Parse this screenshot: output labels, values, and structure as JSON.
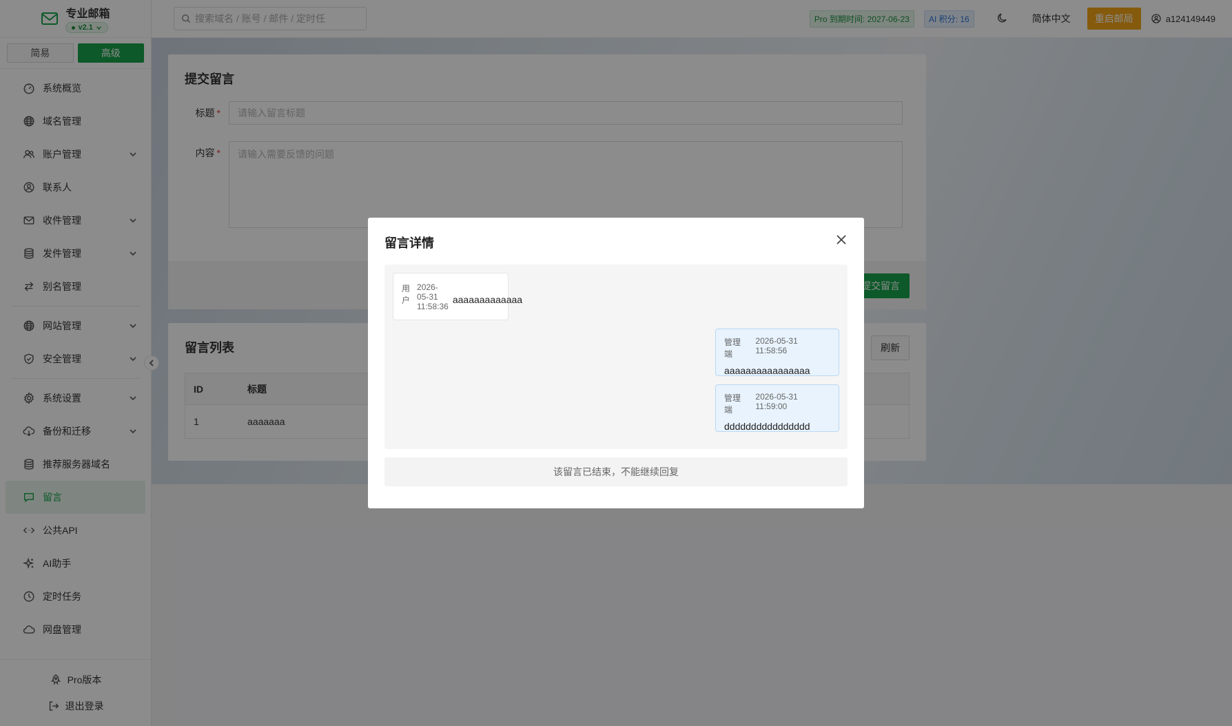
{
  "brand": {
    "name": "专业邮箱",
    "version": "v2.1"
  },
  "mode": {
    "simple": "简易",
    "advanced": "高级"
  },
  "menu": {
    "items": [
      {
        "label": "系统概览",
        "icon": "dashboard-icon",
        "has_chevron": false
      },
      {
        "label": "域名管理",
        "icon": "globe-icon",
        "has_chevron": false
      },
      {
        "label": "账户管理",
        "icon": "users-icon",
        "has_chevron": true
      },
      {
        "label": "联系人",
        "icon": "contact-icon",
        "has_chevron": false
      },
      {
        "label": "收件管理",
        "icon": "mail-icon",
        "has_chevron": true
      },
      {
        "label": "发件管理",
        "icon": "database-icon",
        "has_chevron": true
      },
      {
        "label": "别名管理",
        "icon": "swap-icon",
        "has_chevron": false
      },
      {
        "label": "网站管理",
        "icon": "globe-icon",
        "has_chevron": true
      },
      {
        "label": "安全管理",
        "icon": "shield-icon",
        "has_chevron": true
      },
      {
        "label": "系统设置",
        "icon": "gear-icon",
        "has_chevron": true
      },
      {
        "label": "备份和迁移",
        "icon": "cloud-download-icon",
        "has_chevron": true
      },
      {
        "label": "推荐服务器域名",
        "icon": "database-icon",
        "has_chevron": false
      },
      {
        "label": "留言",
        "icon": "message-icon",
        "has_chevron": false,
        "active": true
      },
      {
        "label": "公共API",
        "icon": "code-icon",
        "has_chevron": false
      },
      {
        "label": "AI助手",
        "icon": "sparkle-icon",
        "has_chevron": false
      },
      {
        "label": "定时任务",
        "icon": "clock-icon",
        "has_chevron": false
      },
      {
        "label": "网盘管理",
        "icon": "cloud-icon",
        "has_chevron": false
      }
    ]
  },
  "sidebar_bottom": {
    "pro": "Pro版本",
    "logout": "退出登录"
  },
  "header": {
    "search_placeholder": "搜索域名 / 账号 / 邮件 / 定时任",
    "pro_tag": "Pro 到期时间: 2027-06-23",
    "ai_tag": "AI 积分: 16",
    "language": "简体中文",
    "restart": "重启邮局",
    "username": "a124149449"
  },
  "submit_card": {
    "title": "提交留言",
    "title_label": "标题",
    "title_placeholder": "请输入留言标题",
    "content_label": "内容",
    "content_placeholder": "请输入需要反馈的问题",
    "submit_button": "提交留言",
    "required_mark": "*"
  },
  "list_card": {
    "title": "留言列表",
    "refresh_button": "刷新",
    "columns": [
      "ID",
      "标题"
    ],
    "rows": [
      {
        "id": "1",
        "title": "aaaaaaa"
      }
    ]
  },
  "modal": {
    "title": "留言详情",
    "messages": [
      {
        "role": "用户",
        "time": "2026-05-31 11:58:36",
        "text": "aaaaaaaaaaaaa"
      },
      {
        "role": "管理端",
        "time": "2026-05-31 11:58:56",
        "text": "aaaaaaaaaaaaaaaa"
      },
      {
        "role": "管理端",
        "time": "2026-05-31 11:59:00",
        "text": "dddddddddddddddd"
      }
    ],
    "closed_note": "该留言已结束，不能继续回复"
  },
  "colors": {
    "brand_green": "#18a24b",
    "warning_orange": "#f2a516",
    "admin_bubble": "#e8f3fd"
  }
}
